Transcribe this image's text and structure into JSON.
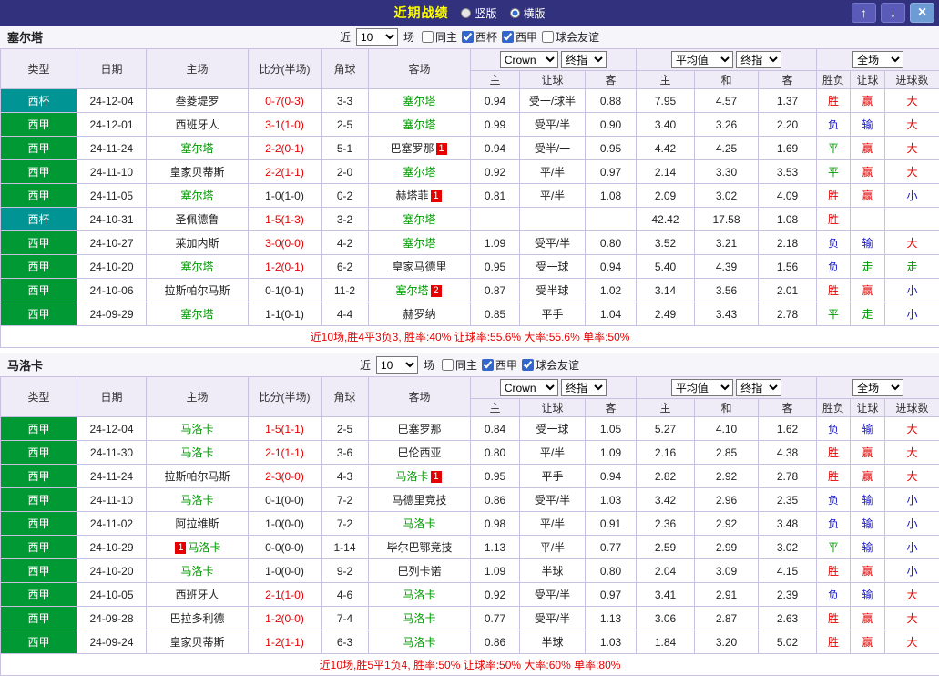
{
  "topbar": {
    "title": "近期战绩",
    "radio_vertical": "竖版",
    "radio_horizontal": "横版",
    "selected": "横版",
    "up": "↑",
    "down": "↓",
    "close": "×"
  },
  "filter_labels": {
    "near": "近",
    "games": "场"
  },
  "dropdowns": {
    "bookmaker": "Crown",
    "final_index_1": "终指",
    "average": "平均值",
    "final_index_2": "终指",
    "full_match": "全场"
  },
  "table_header": {
    "type": "类型",
    "date": "日期",
    "home": "主场",
    "score": "比分(半场)",
    "corner": "角球",
    "away": "客场",
    "odds_sub": [
      "主",
      "让球",
      "客"
    ],
    "euro_sub": [
      "主",
      "和",
      "客"
    ],
    "result_sub": [
      "胜负",
      "让球",
      "进球数"
    ]
  },
  "result_colors": {
    "胜": "red",
    "负": "blue",
    "平": "green",
    "赢": "red",
    "输": "blue",
    "走": "green",
    "大": "red",
    "小": "blue"
  },
  "sections": [
    {
      "team": "塞尔塔",
      "near_count": "10",
      "filters": [
        {
          "label": "同主",
          "checked": false
        },
        {
          "label": "西杯",
          "checked": true
        },
        {
          "label": "西甲",
          "checked": true
        },
        {
          "label": "球会友谊",
          "checked": false
        }
      ],
      "rows": [
        {
          "comp": "西杯",
          "cup": true,
          "date": "24-12-04",
          "home": "叁菱堤罗",
          "home_focus": false,
          "home_badge": null,
          "score": "0-7(0-3)",
          "score_red": true,
          "corner": "3-3",
          "away": "塞尔塔",
          "away_focus": true,
          "away_badge": null,
          "home_odds": "0.94",
          "handicap": "受一/球半",
          "away_odds": "0.88",
          "euro_home": "7.95",
          "euro_draw": "4.57",
          "euro_away": "1.37",
          "result": "胜",
          "handicap_result": "赢",
          "goals_result": "大"
        },
        {
          "comp": "西甲",
          "cup": false,
          "date": "24-12-01",
          "home": "西班牙人",
          "home_focus": false,
          "home_badge": null,
          "score": "3-1(1-0)",
          "score_red": true,
          "corner": "2-5",
          "away": "塞尔塔",
          "away_focus": true,
          "away_badge": null,
          "home_odds": "0.99",
          "handicap": "受平/半",
          "away_odds": "0.90",
          "euro_home": "3.40",
          "euro_draw": "3.26",
          "euro_away": "2.20",
          "result": "负",
          "handicap_result": "输",
          "goals_result": "大"
        },
        {
          "comp": "西甲",
          "cup": false,
          "date": "24-11-24",
          "home": "塞尔塔",
          "home_focus": true,
          "home_badge": null,
          "score": "2-2(0-1)",
          "score_red": true,
          "corner": "5-1",
          "away": "巴塞罗那",
          "away_focus": false,
          "away_badge": {
            "text": "1",
            "pos": "after"
          },
          "home_odds": "0.94",
          "handicap": "受半/一",
          "away_odds": "0.95",
          "euro_home": "4.42",
          "euro_draw": "4.25",
          "euro_away": "1.69",
          "result": "平",
          "handicap_result": "赢",
          "goals_result": "大"
        },
        {
          "comp": "西甲",
          "cup": false,
          "date": "24-11-10",
          "home": "皇家贝蒂斯",
          "home_focus": false,
          "home_badge": null,
          "score": "2-2(1-1)",
          "score_red": true,
          "corner": "2-0",
          "away": "塞尔塔",
          "away_focus": true,
          "away_badge": null,
          "home_odds": "0.92",
          "handicap": "平/半",
          "away_odds": "0.97",
          "euro_home": "2.14",
          "euro_draw": "3.30",
          "euro_away": "3.53",
          "result": "平",
          "handicap_result": "赢",
          "goals_result": "大"
        },
        {
          "comp": "西甲",
          "cup": false,
          "date": "24-11-05",
          "home": "塞尔塔",
          "home_focus": true,
          "home_badge": null,
          "score": "1-0(1-0)",
          "score_red": false,
          "corner": "0-2",
          "away": "赫塔菲",
          "away_focus": false,
          "away_badge": {
            "text": "1",
            "pos": "after"
          },
          "home_odds": "0.81",
          "handicap": "平/半",
          "away_odds": "1.08",
          "euro_home": "2.09",
          "euro_draw": "3.02",
          "euro_away": "4.09",
          "result": "胜",
          "handicap_result": "赢",
          "goals_result": "小"
        },
        {
          "comp": "西杯",
          "cup": true,
          "date": "24-10-31",
          "home": "圣佩德鲁",
          "home_focus": false,
          "home_badge": null,
          "score": "1-5(1-3)",
          "score_red": true,
          "corner": "3-2",
          "away": "塞尔塔",
          "away_focus": true,
          "away_badge": null,
          "home_odds": "",
          "handicap": "",
          "away_odds": "",
          "euro_home": "42.42",
          "euro_draw": "17.58",
          "euro_away": "1.08",
          "result": "胜",
          "handicap_result": "",
          "goals_result": ""
        },
        {
          "comp": "西甲",
          "cup": false,
          "date": "24-10-27",
          "home": "莱加内斯",
          "home_focus": false,
          "home_badge": null,
          "score": "3-0(0-0)",
          "score_red": true,
          "corner": "4-2",
          "away": "塞尔塔",
          "away_focus": true,
          "away_badge": null,
          "home_odds": "1.09",
          "handicap": "受平/半",
          "away_odds": "0.80",
          "euro_home": "3.52",
          "euro_draw": "3.21",
          "euro_away": "2.18",
          "result": "负",
          "handicap_result": "输",
          "goals_result": "大"
        },
        {
          "comp": "西甲",
          "cup": false,
          "date": "24-10-20",
          "home": "塞尔塔",
          "home_focus": true,
          "home_badge": null,
          "score": "1-2(0-1)",
          "score_red": true,
          "corner": "6-2",
          "away": "皇家马德里",
          "away_focus": false,
          "away_badge": null,
          "home_odds": "0.95",
          "handicap": "受一球",
          "away_odds": "0.94",
          "euro_home": "5.40",
          "euro_draw": "4.39",
          "euro_away": "1.56",
          "result": "负",
          "handicap_result": "走",
          "goals_result": "走"
        },
        {
          "comp": "西甲",
          "cup": false,
          "date": "24-10-06",
          "home": "拉斯帕尔马斯",
          "home_focus": false,
          "home_badge": null,
          "score": "0-1(0-1)",
          "score_red": false,
          "corner": "11-2",
          "away": "塞尔塔",
          "away_focus": true,
          "away_badge": {
            "text": "2",
            "pos": "after"
          },
          "home_odds": "0.87",
          "handicap": "受半球",
          "away_odds": "1.02",
          "euro_home": "3.14",
          "euro_draw": "3.56",
          "euro_away": "2.01",
          "result": "胜",
          "handicap_result": "赢",
          "goals_result": "小"
        },
        {
          "comp": "西甲",
          "cup": false,
          "date": "24-09-29",
          "home": "塞尔塔",
          "home_focus": true,
          "home_badge": null,
          "score": "1-1(0-1)",
          "score_red": false,
          "corner": "4-4",
          "away": "赫罗纳",
          "away_focus": false,
          "away_badge": null,
          "home_odds": "0.85",
          "handicap": "平手",
          "away_odds": "1.04",
          "euro_home": "2.49",
          "euro_draw": "3.43",
          "euro_away": "2.78",
          "result": "平",
          "handicap_result": "走",
          "goals_result": "小"
        }
      ],
      "summary": "近10场,胜4平3负3, 胜率:40% 让球率:55.6% 大率:55.6% 单率:50%"
    },
    {
      "team": "马洛卡",
      "near_count": "10",
      "filters": [
        {
          "label": "同主",
          "checked": false
        },
        {
          "label": "西甲",
          "checked": true
        },
        {
          "label": "球会友谊",
          "checked": true
        }
      ],
      "rows": [
        {
          "comp": "西甲",
          "cup": false,
          "date": "24-12-04",
          "home": "马洛卡",
          "home_focus": true,
          "home_badge": null,
          "score": "1-5(1-1)",
          "score_red": true,
          "corner": "2-5",
          "away": "巴塞罗那",
          "away_focus": false,
          "away_badge": null,
          "home_odds": "0.84",
          "handicap": "受一球",
          "away_odds": "1.05",
          "euro_home": "5.27",
          "euro_draw": "4.10",
          "euro_away": "1.62",
          "result": "负",
          "handicap_result": "输",
          "goals_result": "大"
        },
        {
          "comp": "西甲",
          "cup": false,
          "date": "24-11-30",
          "home": "马洛卡",
          "home_focus": true,
          "home_badge": null,
          "score": "2-1(1-1)",
          "score_red": true,
          "corner": "3-6",
          "away": "巴伦西亚",
          "away_focus": false,
          "away_badge": null,
          "home_odds": "0.80",
          "handicap": "平/半",
          "away_odds": "1.09",
          "euro_home": "2.16",
          "euro_draw": "2.85",
          "euro_away": "4.38",
          "result": "胜",
          "handicap_result": "赢",
          "goals_result": "大"
        },
        {
          "comp": "西甲",
          "cup": false,
          "date": "24-11-24",
          "home": "拉斯帕尔马斯",
          "home_focus": false,
          "home_badge": null,
          "score": "2-3(0-0)",
          "score_red": true,
          "corner": "4-3",
          "away": "马洛卡",
          "away_focus": true,
          "away_badge": {
            "text": "1",
            "pos": "after"
          },
          "home_odds": "0.95",
          "handicap": "平手",
          "away_odds": "0.94",
          "euro_home": "2.82",
          "euro_draw": "2.92",
          "euro_away": "2.78",
          "result": "胜",
          "handicap_result": "赢",
          "goals_result": "大"
        },
        {
          "comp": "西甲",
          "cup": false,
          "date": "24-11-10",
          "home": "马洛卡",
          "home_focus": true,
          "home_badge": null,
          "score": "0-1(0-0)",
          "score_red": false,
          "corner": "7-2",
          "away": "马德里竞技",
          "away_focus": false,
          "away_badge": null,
          "home_odds": "0.86",
          "handicap": "受平/半",
          "away_odds": "1.03",
          "euro_home": "3.42",
          "euro_draw": "2.96",
          "euro_away": "2.35",
          "result": "负",
          "handicap_result": "输",
          "goals_result": "小"
        },
        {
          "comp": "西甲",
          "cup": false,
          "date": "24-11-02",
          "home": "阿拉维斯",
          "home_focus": false,
          "home_badge": null,
          "score": "1-0(0-0)",
          "score_red": false,
          "corner": "7-2",
          "away": "马洛卡",
          "away_focus": true,
          "away_badge": null,
          "home_odds": "0.98",
          "handicap": "平/半",
          "away_odds": "0.91",
          "euro_home": "2.36",
          "euro_draw": "2.92",
          "euro_away": "3.48",
          "result": "负",
          "handicap_result": "输",
          "goals_result": "小"
        },
        {
          "comp": "西甲",
          "cup": false,
          "date": "24-10-29",
          "home": "马洛卡",
          "home_focus": true,
          "home_badge": {
            "text": "1",
            "pos": "before"
          },
          "score": "0-0(0-0)",
          "score_red": false,
          "corner": "1-14",
          "away": "毕尔巴鄂竞技",
          "away_focus": false,
          "away_badge": null,
          "home_odds": "1.13",
          "handicap": "平/半",
          "away_odds": "0.77",
          "euro_home": "2.59",
          "euro_draw": "2.99",
          "euro_away": "3.02",
          "result": "平",
          "handicap_result": "输",
          "goals_result": "小"
        },
        {
          "comp": "西甲",
          "cup": false,
          "date": "24-10-20",
          "home": "马洛卡",
          "home_focus": true,
          "home_badge": null,
          "score": "1-0(0-0)",
          "score_red": false,
          "corner": "9-2",
          "away": "巴列卡诺",
          "away_focus": false,
          "away_badge": null,
          "home_odds": "1.09",
          "handicap": "半球",
          "away_odds": "0.80",
          "euro_home": "2.04",
          "euro_draw": "3.09",
          "euro_away": "4.15",
          "result": "胜",
          "handicap_result": "赢",
          "goals_result": "小"
        },
        {
          "comp": "西甲",
          "cup": false,
          "date": "24-10-05",
          "home": "西班牙人",
          "home_focus": false,
          "home_badge": null,
          "score": "2-1(1-0)",
          "score_red": true,
          "corner": "4-6",
          "away": "马洛卡",
          "away_focus": true,
          "away_badge": null,
          "home_odds": "0.92",
          "handicap": "受平/半",
          "away_odds": "0.97",
          "euro_home": "3.41",
          "euro_draw": "2.91",
          "euro_away": "2.39",
          "result": "负",
          "handicap_result": "输",
          "goals_result": "大"
        },
        {
          "comp": "西甲",
          "cup": false,
          "date": "24-09-28",
          "home": "巴拉多利德",
          "home_focus": false,
          "home_badge": null,
          "score": "1-2(0-0)",
          "score_red": true,
          "corner": "7-4",
          "away": "马洛卡",
          "away_focus": true,
          "away_badge": null,
          "home_odds": "0.77",
          "handicap": "受平/半",
          "away_odds": "1.13",
          "euro_home": "3.06",
          "euro_draw": "2.87",
          "euro_away": "2.63",
          "result": "胜",
          "handicap_result": "赢",
          "goals_result": "大"
        },
        {
          "comp": "西甲",
          "cup": false,
          "date": "24-09-24",
          "home": "皇家贝蒂斯",
          "home_focus": false,
          "home_badge": null,
          "score": "1-2(1-1)",
          "score_red": true,
          "corner": "6-3",
          "away": "马洛卡",
          "away_focus": true,
          "away_badge": null,
          "home_odds": "0.86",
          "handicap": "半球",
          "away_odds": "1.03",
          "euro_home": "1.84",
          "euro_draw": "3.20",
          "euro_away": "5.02",
          "result": "胜",
          "handicap_result": "赢",
          "goals_result": "大"
        }
      ],
      "summary": "近10场,胜5平1负4, 胜率:50% 让球率:50% 大率:60% 单率:80%"
    }
  ]
}
